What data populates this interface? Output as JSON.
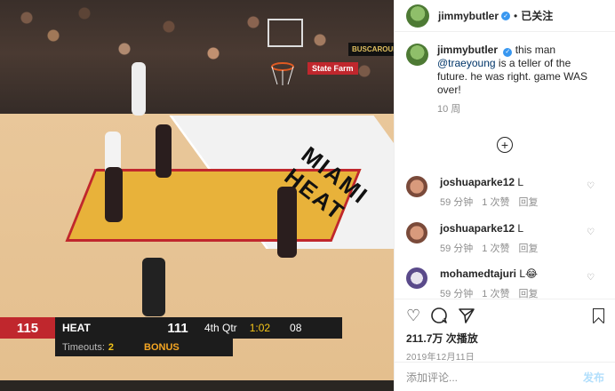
{
  "post": {
    "username": "jimmybutler",
    "follow_status": "已关注",
    "caption_user": "jimmybutler",
    "caption_pre": "this man",
    "caption_mention": "@traeyoung",
    "caption_post": "is a teller of the future. he was right. game WAS over!",
    "age": "10 周"
  },
  "comments": [
    {
      "user": "joshuaparke12",
      "text": "L",
      "time": "59 分钟",
      "likes": "1 次赞",
      "reply": "回复"
    },
    {
      "user": "joshuaparke12",
      "text": "L",
      "time": "59 分钟",
      "likes": "1 次赞",
      "reply": "回复"
    },
    {
      "user": "mohamedtajuri",
      "text": "L😂",
      "time": "59 分钟",
      "likes": "1 次赞",
      "reply": "回复"
    }
  ],
  "stats": {
    "views": "211.7万 次播放",
    "date": "2019年12月11日"
  },
  "add_comment": {
    "placeholder": "添加评论...",
    "post_label": "发布"
  },
  "video": {
    "home_score": "115",
    "home_team": "HEAT",
    "away_score": "111",
    "quarter": "4th Qtr",
    "clock": "1:02",
    "shot_clock": "08",
    "timeouts_label": "Timeouts:",
    "timeouts_value": "2",
    "bonus": "BONUS",
    "court_text": "MIAMI HEAT",
    "arena_sign": "BUSCAROUR",
    "sponsor": "State Farm"
  },
  "colors": {
    "heat_red": "#c0272d",
    "link": "#003569",
    "verified": "#3897f0",
    "meta": "#8e8e8e"
  }
}
